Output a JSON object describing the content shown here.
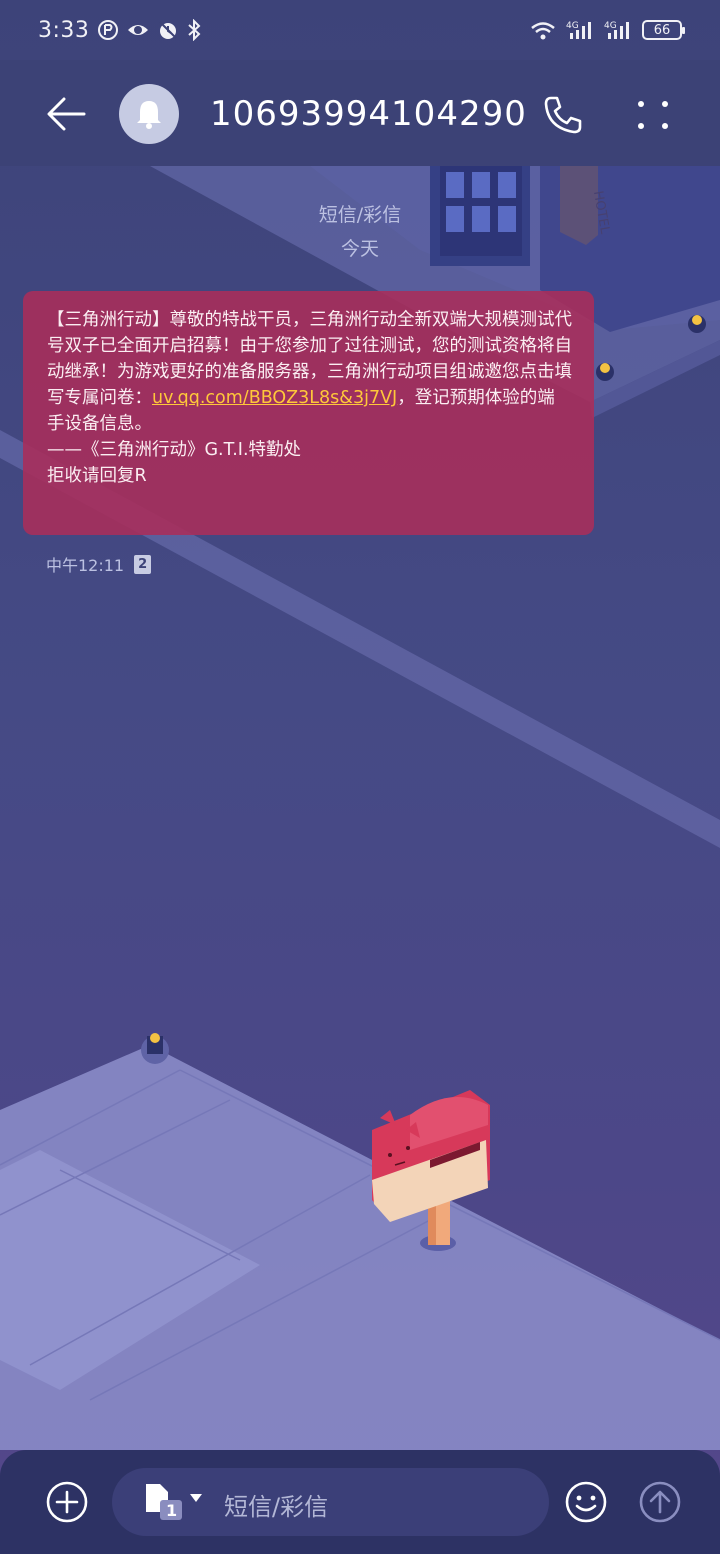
{
  "status_bar": {
    "time": "3:33",
    "battery": "66",
    "network_1": "4G",
    "network_2": "4G"
  },
  "header": {
    "contact_number": "10693994104290",
    "avatar_icon": "bell-icon"
  },
  "conversation": {
    "sep_type": "短信/彩信",
    "sep_date": "今天",
    "message": {
      "text_1": "【三角洲行动】尊敬的特战干员，三角洲行动全新双端大规模测试代号双子已全面开启招募！由于您参加了过往测试，您的测试资格将自动继承！为游戏更好的准备服务器，三角洲行动项目组诚邀您点击填写专属问卷：",
      "link": "uv.qq.com/BBOZ3L8s&3j7VJ",
      "text_2": "，登记预期体验的端手设备信息。",
      "signature": "——《三角洲行动》G.T.I.特勤处",
      "unsubscribe": "拒收请回复R",
      "time": "中午12:11",
      "sim": "2"
    }
  },
  "input_bar": {
    "placeholder": "短信/彩信",
    "sim_slot": "1"
  },
  "colors": {
    "background": "#41477f",
    "bubble": "#a82d5a",
    "link": "#ffc83a"
  }
}
